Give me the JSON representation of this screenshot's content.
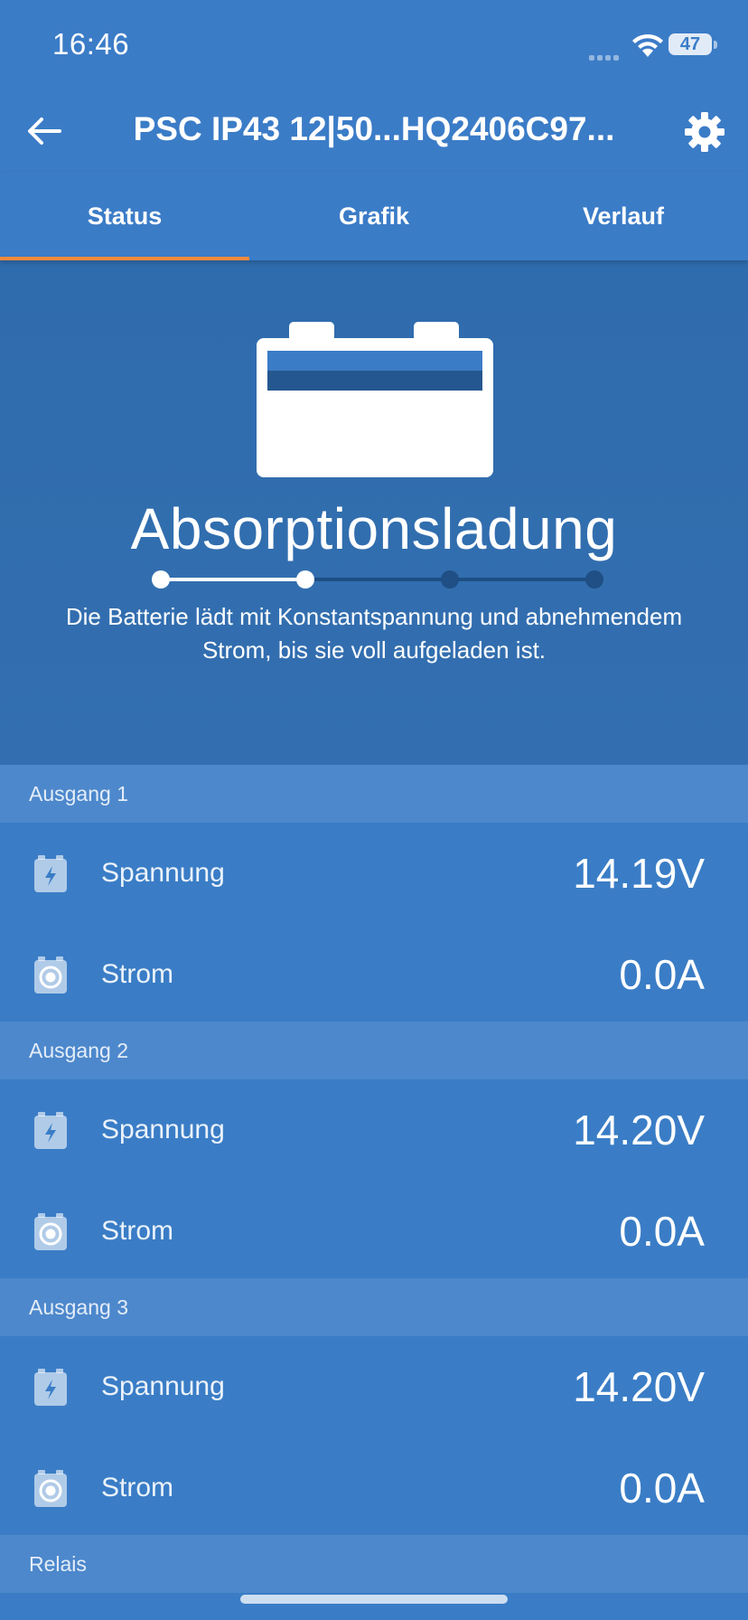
{
  "status_bar": {
    "time": "16:46",
    "battery_level": "47"
  },
  "header": {
    "title": "PSC IP43 12|50...HQ2406C97..."
  },
  "tabs": [
    {
      "label": "Status",
      "active": true
    },
    {
      "label": "Grafik",
      "active": false
    },
    {
      "label": "Verlauf",
      "active": false
    }
  ],
  "hero": {
    "state": "Absorptionsladung",
    "description": "Die Batterie lädt mit Konstantspannung und abnehmendem Strom, bis sie voll aufgeladen ist.",
    "stages_total": 4,
    "stage_current": 2
  },
  "outputs": [
    {
      "heading": "Ausgang 1",
      "voltage_label": "Spannung",
      "voltage": "14.19V",
      "current_label": "Strom",
      "current": "0.0A"
    },
    {
      "heading": "Ausgang 2",
      "voltage_label": "Spannung",
      "voltage": "14.20V",
      "current_label": "Strom",
      "current": "0.0A"
    },
    {
      "heading": "Ausgang 3",
      "voltage_label": "Spannung",
      "voltage": "14.20V",
      "current_label": "Strom",
      "current": "0.0A"
    }
  ],
  "relay": {
    "heading": "Relais"
  },
  "colors": {
    "primary": "#3a7dc6",
    "section_header": "#4d88cc",
    "hero": "#2f6cad",
    "tab_accent": "#f08a3c"
  }
}
